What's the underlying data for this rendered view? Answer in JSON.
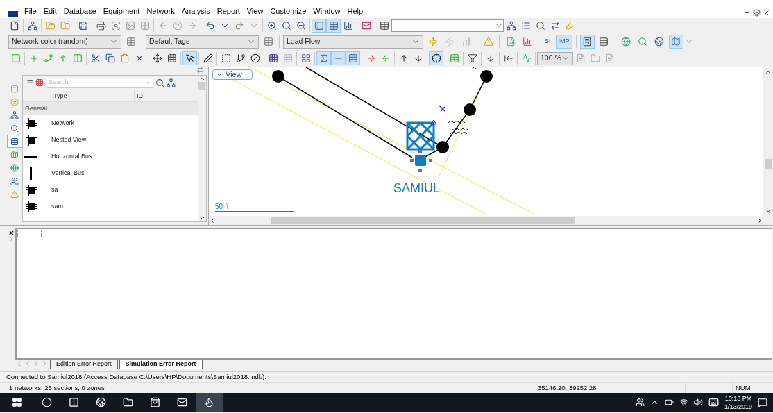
{
  "menu": [
    "File",
    "Edit",
    "Database",
    "Equipment",
    "Network",
    "Analysis",
    "Report",
    "View",
    "Customize",
    "Window",
    "Help"
  ],
  "toolbar_1": {
    "buttons_a": [
      {
        "selected": false
      },
      {
        "selected": false
      },
      {
        "selected": false
      },
      {
        "selected": false
      },
      {
        "selected": false
      },
      {
        "selected": false
      },
      {
        "selected": false
      },
      {
        "selected": false
      },
      {
        "selected": false
      },
      {
        "selected": false
      },
      {
        "selected": false
      },
      {
        "selected": false
      },
      {
        "selected": false
      },
      {
        "selected": false
      },
      {
        "selected": false
      },
      {
        "selected": false
      },
      {
        "selected": false
      },
      {
        "selected": false
      },
      {
        "selected": false
      },
      {
        "selected": true
      },
      {
        "selected": true
      },
      {
        "selected": false
      },
      {
        "selected": false
      }
    ],
    "buttons_b": [
      {
        "selected": false
      },
      {
        "selected": false
      },
      {
        "selected": false
      },
      {
        "selected": false
      },
      {
        "selected": false
      }
    ]
  },
  "toolbar_2": {
    "dropdowns": [
      "Network color (random)",
      "Default Tags",
      "Load Flow"
    ],
    "buttons": [
      {
        "selected": false
      },
      {
        "selected": false
      },
      {
        "selected": false
      },
      {
        "selected": false
      },
      {
        "selected": false
      },
      {
        "selected": false
      }
    ],
    "units": [
      {
        "label": "SI",
        "selected": false
      },
      {
        "label": "IMP",
        "selected": true
      }
    ],
    "buttons_b": [
      {
        "selected": true
      },
      {
        "selected": false
      },
      {
        "selected": false
      },
      {
        "selected": false
      },
      {
        "selected": false
      },
      {
        "selected": true
      }
    ]
  },
  "toolbar_3": {
    "buttons": [
      {
        "selected": false
      },
      {
        "selected": false
      },
      {
        "selected": false
      },
      {
        "selected": false
      },
      {
        "selected": false
      },
      {
        "selected": false
      },
      {
        "selected": false
      },
      {
        "selected": false
      },
      {
        "selected": false
      },
      {
        "selected": false
      },
      {
        "selected": false
      },
      {
        "selected": true
      },
      {
        "selected": false
      },
      {
        "selected": false
      },
      {
        "selected": false
      },
      {
        "selected": false
      },
      {
        "selected": false
      },
      {
        "selected": false
      },
      {
        "selected": false
      },
      {
        "selected": true
      },
      {
        "selected": true
      },
      {
        "selected": true
      },
      {
        "selected": false
      },
      {
        "selected": false
      },
      {
        "selected": false
      },
      {
        "selected": false
      },
      {
        "selected": true
      },
      {
        "selected": false
      },
      {
        "selected": false
      },
      {
        "selected": false
      },
      {
        "selected": false
      },
      {
        "selected": false
      }
    ],
    "zoom": "100 %"
  },
  "catalog": {
    "search_placeholder": "Search",
    "columns": [
      "Type",
      "ID"
    ],
    "group": "General",
    "rows": [
      {
        "kind": "element",
        "label": "Network"
      },
      {
        "kind": "element",
        "label": "Nested View"
      },
      {
        "kind": "hbus",
        "label": "Horizontal Bus"
      },
      {
        "kind": "vbus",
        "label": "Vertical Bus"
      },
      {
        "kind": "element",
        "label": "sa"
      },
      {
        "kind": "element",
        "label": "sam"
      }
    ],
    "side_tabs": [
      {
        "selected": false
      },
      {
        "selected": false
      },
      {
        "selected": false
      },
      {
        "selected": false
      },
      {
        "selected": true
      },
      {
        "selected": false
      },
      {
        "selected": false
      },
      {
        "selected": false
      },
      {
        "selected": false
      }
    ]
  },
  "canvas": {
    "view_button": "View",
    "label": "SAMIUL",
    "scale": "50 ft"
  },
  "report": {
    "tabs": [
      {
        "label": "Edition Error Report",
        "selected": false
      },
      {
        "label": "Simulation Error Report",
        "selected": true
      }
    ]
  },
  "status": {
    "message": "Connected to Samiul2018 (Access Database C:\\Users\\HP\\Documents\\Samiul2018.mdb).",
    "summary": "1 networks, 25 sections, 0 zones",
    "coordinates": "35146.20, 39252.28",
    "num": "NUM"
  },
  "taskbar": {
    "apps": [
      {
        "selected": false
      },
      {
        "selected": false
      },
      {
        "selected": false
      },
      {
        "selected": false
      },
      {
        "selected": false
      },
      {
        "selected": false
      },
      {
        "selected": true
      }
    ],
    "time": "10:13 PM",
    "date": "1/13/2019"
  }
}
